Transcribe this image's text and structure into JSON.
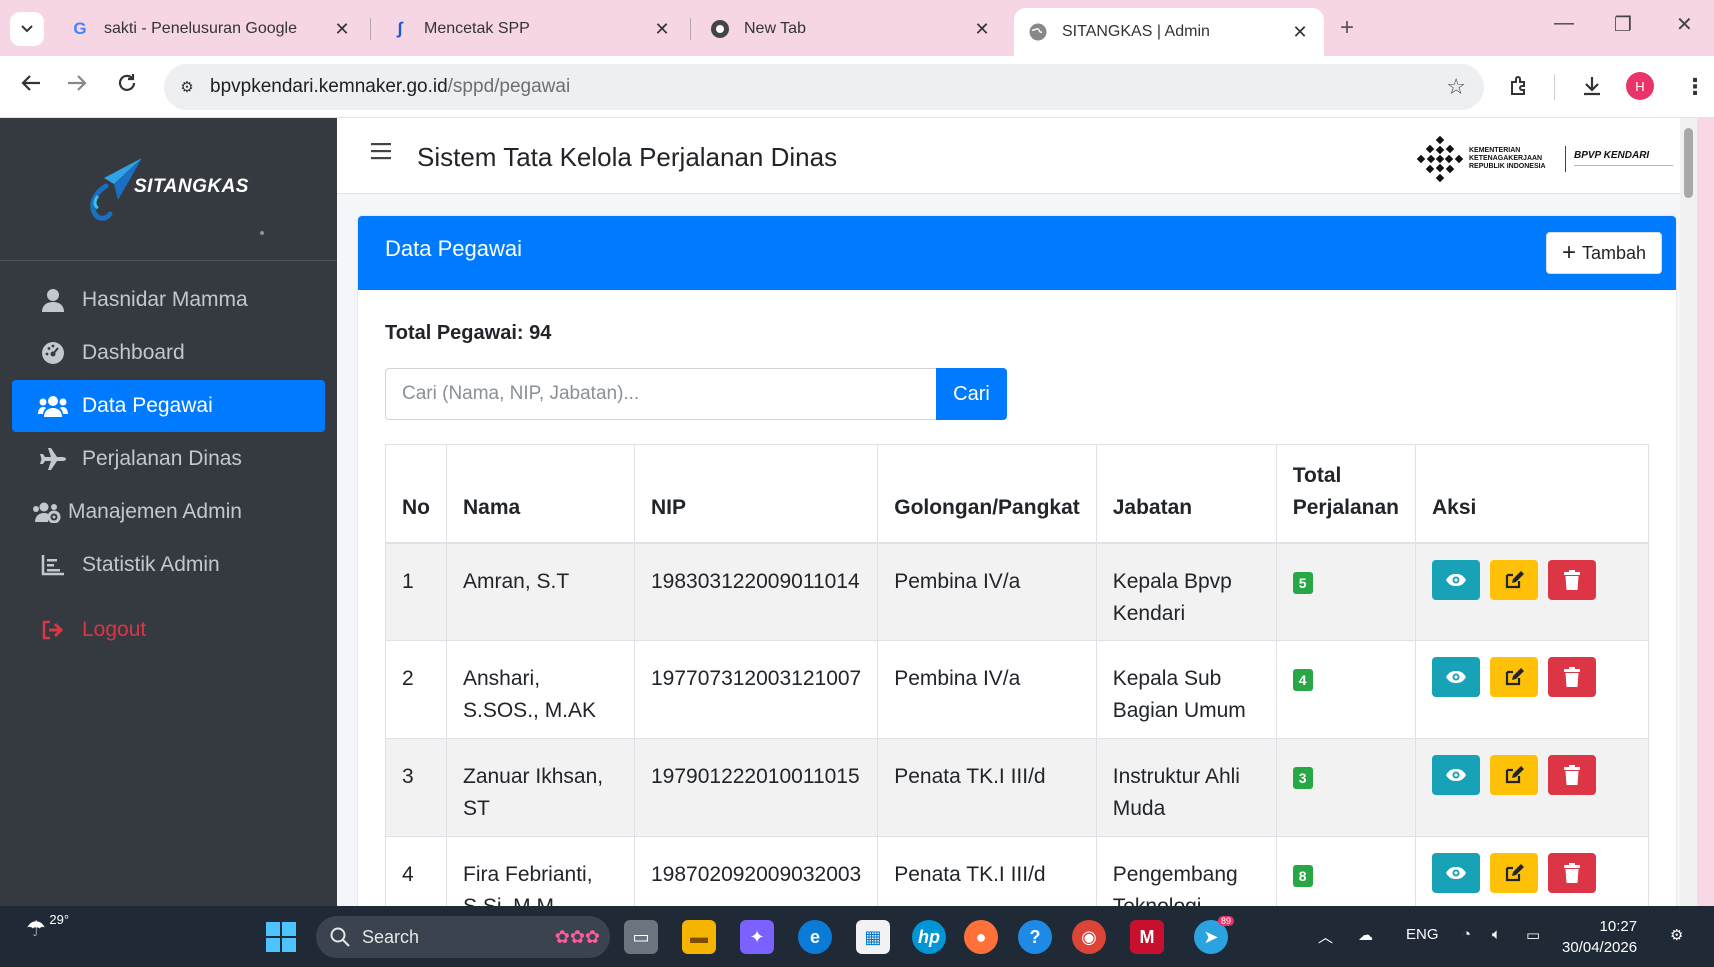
{
  "browser": {
    "tabs": [
      {
        "label": "sakti - Penelusuran Google"
      },
      {
        "label": "Mencetak SPP"
      },
      {
        "label": "New Tab"
      },
      {
        "label": "SITANGKAS | Admin"
      }
    ],
    "url_host": "bpvpkendari.kemnaker.go.id",
    "url_path": "/sppd/pegawai",
    "profile_initial": "H"
  },
  "sidebar": {
    "brand": "SITANGKAS",
    "items": [
      {
        "label": "Hasnidar Mamma",
        "icon": "user-icon"
      },
      {
        "label": "Dashboard",
        "icon": "gauge-icon"
      },
      {
        "label": "Data Pegawai",
        "icon": "users-icon"
      },
      {
        "label": "Perjalanan Dinas",
        "icon": "plane-icon"
      },
      {
        "label": "Manajemen Admin",
        "icon": "users-cog-icon"
      },
      {
        "label": "Statistik Admin",
        "icon": "chart-icon"
      },
      {
        "label": "Logout",
        "icon": "logout-icon"
      }
    ]
  },
  "header": {
    "title": "Sistem Tata Kelola Perjalanan Dinas",
    "ministry_text": "KEMENTERIAN KETENAGAKERJAAN REPUBLIK INDONESIA",
    "bpvp_text": "BPVP KENDARI"
  },
  "card": {
    "title": "Data Pegawai",
    "add_label": "Tambah",
    "total_label": "Total Pegawai: 94",
    "search_placeholder": "Cari (Nama, NIP, Jabatan)...",
    "search_button": "Cari"
  },
  "table": {
    "headers": {
      "no": "No",
      "nama": "Nama",
      "nip": "NIP",
      "golongan": "Golongan/Pangkat",
      "jabatan": "Jabatan",
      "total_1": "Total",
      "total_2": "Perjalanan",
      "aksi": "Aksi"
    },
    "rows": [
      {
        "no": "1",
        "nama": "Amran, S.T",
        "nip": "198303122009011014",
        "golongan": "Pembina IV/a",
        "jabatan": "Kepala Bpvp Kendari",
        "total": "5"
      },
      {
        "no": "2",
        "nama": "Anshari, S.SOS., M.AK",
        "nip": "197707312003121007",
        "golongan": "Pembina IV/a",
        "jabatan": "Kepala Sub Bagian Umum",
        "total": "4"
      },
      {
        "no": "3",
        "nama": "Zanuar Ikhsan, ST",
        "nip": "197901222010011015",
        "golongan": "Penata TK.I III/d",
        "jabatan": "Instruktur Ahli Muda",
        "total": "3"
      },
      {
        "no": "4",
        "nama": "Fira Febrianti, S.Si, M.M",
        "nip": "198702092009032003",
        "golongan": "Penata TK.I III/d",
        "jabatan": "Pengembang Teknologi",
        "total": "8"
      }
    ]
  },
  "taskbar": {
    "weather_temp": "29°",
    "search_label": "Search",
    "lang": "ENG",
    "time": "10:27",
    "date": "30/04/2026",
    "telegram_badge": "89"
  },
  "colors": {
    "primary": "#007bff",
    "sidebar_bg": "#343a40",
    "success": "#28a745",
    "info": "#17a2b8",
    "warning": "#ffc107",
    "danger": "#dc3545"
  }
}
